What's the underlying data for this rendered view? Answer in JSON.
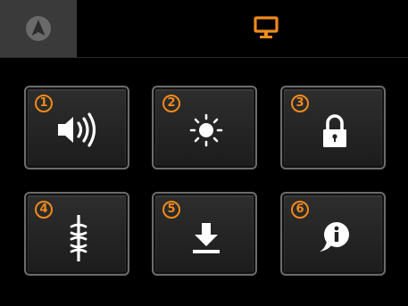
{
  "header": {
    "tabs": [
      {
        "icon": "navigation-arrow-icon",
        "active": false
      },
      {
        "icon": "display-monitor-icon",
        "active": true
      }
    ]
  },
  "colors": {
    "accent": "#f08a1c",
    "tile_border": "#6b6b6b",
    "tile_background": "#262626",
    "inactive_tab": "#3a3a3a",
    "background": "#000000"
  },
  "tiles": [
    {
      "number": "1",
      "icon": "volume-icon"
    },
    {
      "number": "2",
      "icon": "brightness-icon"
    },
    {
      "number": "3",
      "icon": "lock-icon"
    },
    {
      "number": "4",
      "icon": "antenna-icon"
    },
    {
      "number": "5",
      "icon": "download-icon"
    },
    {
      "number": "6",
      "icon": "info-icon"
    }
  ]
}
